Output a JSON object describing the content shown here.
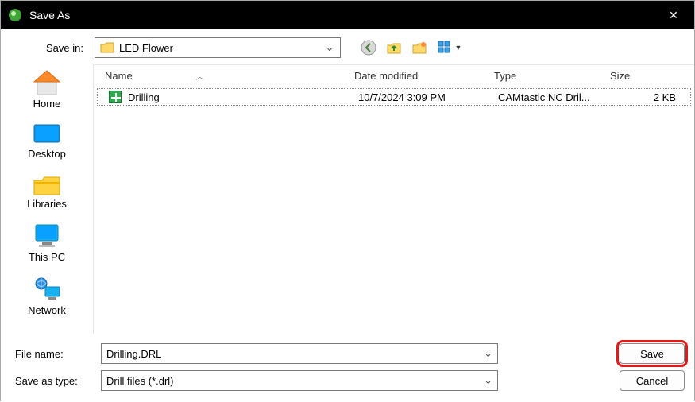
{
  "window": {
    "title": "Save As",
    "close_glyph": "✕"
  },
  "toolbar": {
    "savein_label": "Save in:",
    "folder_name": "LED Flower",
    "back_icon": "back-icon",
    "up_icon": "up-folder-icon",
    "new_folder_icon": "new-folder-icon",
    "views_icon": "views-icon"
  },
  "places": [
    {
      "id": "home",
      "label": "Home"
    },
    {
      "id": "desktop",
      "label": "Desktop"
    },
    {
      "id": "libraries",
      "label": "Libraries"
    },
    {
      "id": "thispc",
      "label": "This PC"
    },
    {
      "id": "network",
      "label": "Network"
    }
  ],
  "columns": {
    "name": "Name",
    "date": "Date modified",
    "type": "Type",
    "size": "Size",
    "sort_glyph": "︿"
  },
  "files": [
    {
      "name": "Drilling",
      "date": "10/7/2024 3:09 PM",
      "type": "CAMtastic NC Dril...",
      "size": "2 KB"
    }
  ],
  "form": {
    "filename_label": "File name:",
    "filename_value": "Drilling.DRL",
    "savetype_label": "Save as type:",
    "savetype_value": "Drill files (*.drl)"
  },
  "buttons": {
    "save": "Save",
    "cancel": "Cancel"
  }
}
